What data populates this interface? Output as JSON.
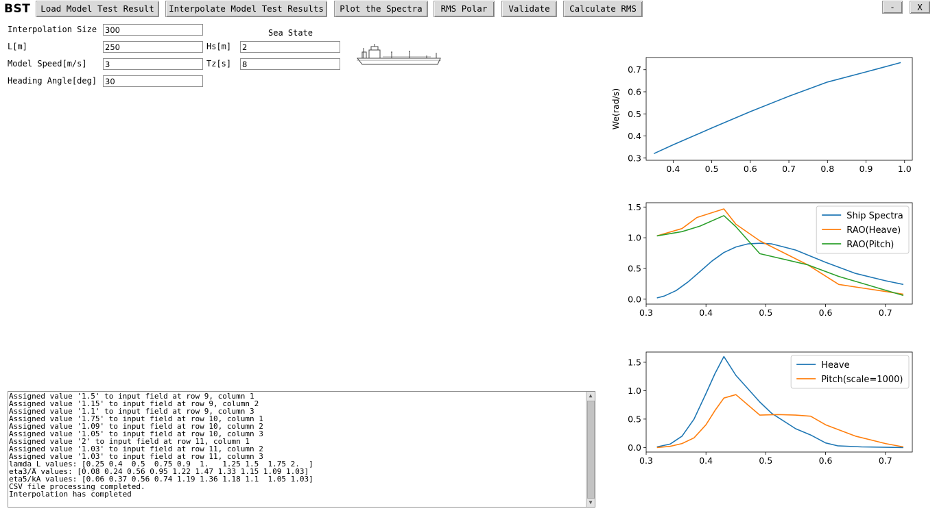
{
  "app": {
    "logo": "BST",
    "minimize_label": "-",
    "close_label": "X"
  },
  "toolbar": {
    "load": "Load Model Test Result",
    "interpolate": "Interpolate Model Test Results",
    "plot": "Plot the Spectra",
    "rms_polar": "RMS Polar",
    "validate": "Validate",
    "calc_rms": "Calculate RMS"
  },
  "form": {
    "interp_size": {
      "label": "Interpolation Size",
      "value": "300"
    },
    "length": {
      "label": "L[m]",
      "value": "250"
    },
    "speed": {
      "label": "Model Speed[m/s]",
      "value": "3"
    },
    "heading": {
      "label": "Heading Angle[deg]",
      "value": "30"
    },
    "sea_state_title": "Sea State",
    "hs": {
      "label": "Hs[m]",
      "value": "2"
    },
    "tz": {
      "label": "Tz[s]",
      "value": "8"
    }
  },
  "log": {
    "lines": [
      "Assigned value '1.5' to input field at row 9, column 1",
      "Assigned value '1.15' to input field at row 9, column 2",
      "Assigned value '1.1' to input field at row 9, column 3",
      "Assigned value '1.75' to input field at row 10, column 1",
      "Assigned value '1.09' to input field at row 10, column 2",
      "Assigned value '1.05' to input field at row 10, column 3",
      "Assigned value '2' to input field at row 11, column 1",
      "Assigned value '1.03' to input field at row 11, column 2",
      "Assigned value '1.03' to input field at row 11, column 3",
      "lamda_L values: [0.25 0.4  0.5  0.75 0.9  1.   1.25 1.5  1.75 2.  ]",
      "eta3/A values: [0.08 0.24 0.56 0.95 1.22 1.47 1.33 1.15 1.09 1.03]",
      "eta5/kA values: [0.06 0.37 0.56 0.74 1.19 1.36 1.18 1.1  1.05 1.03]",
      "CSV file processing completed.",
      "Interpolation has completed"
    ]
  },
  "colors": {
    "blue": "#1f77b4",
    "orange": "#ff7f0e",
    "green": "#2ca02c"
  },
  "chart_data": [
    {
      "type": "line",
      "ylabel": "We(rad/s)",
      "xlabel": "",
      "xlim": [
        0.33,
        1.02
      ],
      "ylim": [
        0.29,
        0.755
      ],
      "xticks": [
        0.4,
        0.5,
        0.6,
        0.7,
        0.8,
        0.9,
        1.0
      ],
      "xticklabels": [
        "0.4",
        "0.5",
        "0.6",
        "0.7",
        "0.8",
        "0.9",
        "1.0"
      ],
      "yticks": [
        0.3,
        0.4,
        0.5,
        0.6,
        0.7
      ],
      "yticklabels": [
        "0.3",
        "0.4",
        "0.5",
        "0.6",
        "0.7"
      ],
      "legend": "",
      "series": [
        {
          "color": "#1f77b4",
          "x": [
            0.35,
            0.4,
            0.5,
            0.6,
            0.7,
            0.8,
            0.9,
            0.99
          ],
          "y": [
            0.32,
            0.36,
            0.436,
            0.51,
            0.58,
            0.644,
            0.69,
            0.732
          ]
        }
      ]
    },
    {
      "type": "line",
      "xlim": [
        0.3,
        0.745
      ],
      "ylim": [
        -0.08,
        1.57
      ],
      "xticks": [
        0.3,
        0.4,
        0.5,
        0.6,
        0.7
      ],
      "xticklabels": [
        "0.3",
        "0.4",
        "0.5",
        "0.6",
        "0.7"
      ],
      "yticks": [
        0.0,
        0.5,
        1.0,
        1.5
      ],
      "yticklabels": [
        "0.0",
        "0.5",
        "1.0",
        "1.5"
      ],
      "legend": "top-right",
      "series": [
        {
          "name": "Ship Spectra",
          "color": "#1f77b4",
          "x": [
            0.318,
            0.33,
            0.35,
            0.37,
            0.39,
            0.41,
            0.43,
            0.45,
            0.47,
            0.49,
            0.51,
            0.55,
            0.6,
            0.65,
            0.7,
            0.73
          ],
          "y": [
            0.02,
            0.05,
            0.14,
            0.28,
            0.45,
            0.62,
            0.76,
            0.85,
            0.9,
            0.91,
            0.9,
            0.8,
            0.6,
            0.42,
            0.3,
            0.24
          ]
        },
        {
          "name": "RAO(Heave)",
          "color": "#ff7f0e",
          "x": [
            0.318,
            0.36,
            0.385,
            0.43,
            0.45,
            0.49,
            0.57,
            0.622,
            0.73
          ],
          "y": [
            1.03,
            1.15,
            1.33,
            1.47,
            1.22,
            0.95,
            0.56,
            0.24,
            0.08
          ]
        },
        {
          "name": "RAO(Pitch)",
          "color": "#2ca02c",
          "x": [
            0.318,
            0.36,
            0.39,
            0.43,
            0.45,
            0.49,
            0.57,
            0.622,
            0.73
          ],
          "y": [
            1.03,
            1.1,
            1.19,
            1.36,
            1.18,
            0.74,
            0.56,
            0.37,
            0.06
          ]
        }
      ]
    },
    {
      "type": "line",
      "xlim": [
        0.3,
        0.745
      ],
      "ylim": [
        -0.08,
        1.68
      ],
      "xticks": [
        0.3,
        0.4,
        0.5,
        0.6,
        0.7
      ],
      "xticklabels": [
        "0.3",
        "0.4",
        "0.5",
        "0.6",
        "0.7"
      ],
      "yticks": [
        0.0,
        0.5,
        1.0,
        1.5
      ],
      "yticklabels": [
        "0.0",
        "0.5",
        "1.0",
        "1.5"
      ],
      "legend": "top-right",
      "series": [
        {
          "name": "Heave",
          "color": "#1f77b4",
          "x": [
            0.318,
            0.34,
            0.36,
            0.38,
            0.4,
            0.415,
            0.43,
            0.45,
            0.49,
            0.51,
            0.55,
            0.575,
            0.6,
            0.62,
            0.66,
            0.73
          ],
          "y": [
            0.01,
            0.06,
            0.2,
            0.5,
            0.95,
            1.3,
            1.6,
            1.27,
            0.8,
            0.6,
            0.33,
            0.22,
            0.08,
            0.03,
            0.01,
            0.0
          ]
        },
        {
          "name": "Pitch(scale=1000)",
          "color": "#ff7f0e",
          "x": [
            0.318,
            0.34,
            0.36,
            0.38,
            0.4,
            0.415,
            0.43,
            0.45,
            0.49,
            0.52,
            0.55,
            0.575,
            0.6,
            0.65,
            0.7,
            0.73
          ],
          "y": [
            0.0,
            0.02,
            0.07,
            0.17,
            0.4,
            0.65,
            0.87,
            0.93,
            0.57,
            0.58,
            0.57,
            0.55,
            0.4,
            0.2,
            0.07,
            0.01
          ]
        }
      ]
    }
  ]
}
